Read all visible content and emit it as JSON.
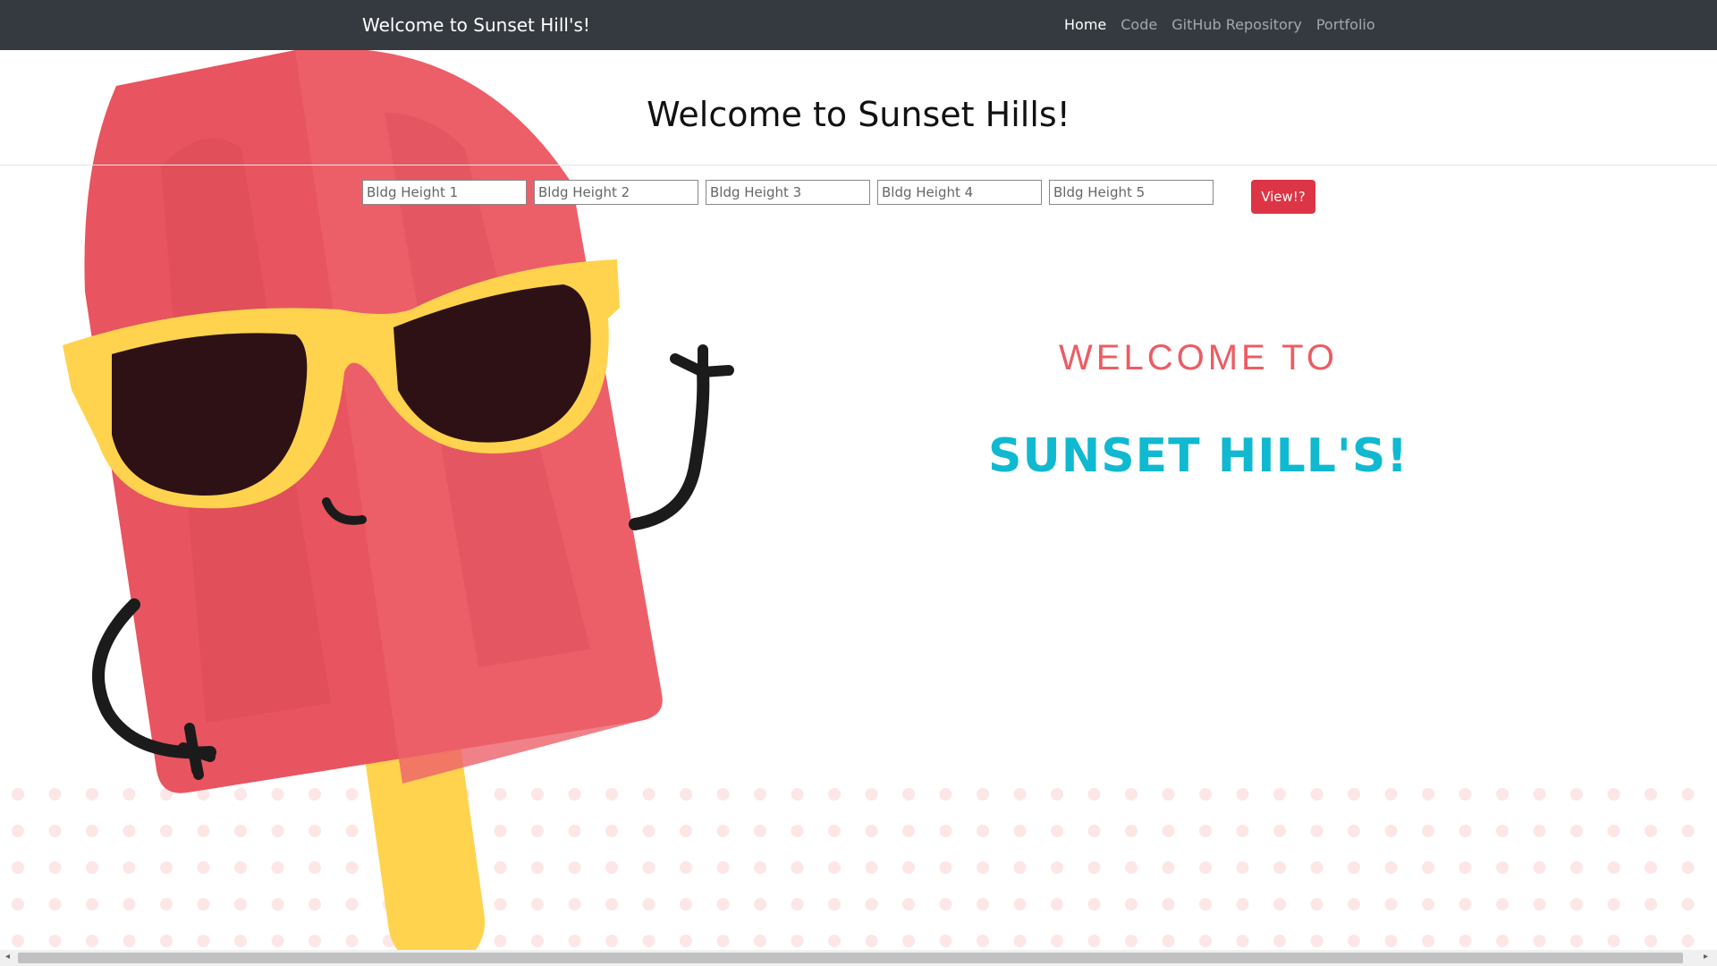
{
  "navbar": {
    "brand": "Welcome to Sunset Hill's!",
    "links": [
      {
        "label": "Home",
        "active": true
      },
      {
        "label": "Code",
        "active": false
      },
      {
        "label": "GitHub Repository",
        "active": false
      },
      {
        "label": "Portfolio",
        "active": false
      }
    ]
  },
  "header": {
    "title": "Welcome to Sunset Hills!"
  },
  "form": {
    "inputs": [
      {
        "placeholder": "Bldg Height 1",
        "value": ""
      },
      {
        "placeholder": "Bldg Height 2",
        "value": ""
      },
      {
        "placeholder": "Bldg Height 3",
        "value": ""
      },
      {
        "placeholder": "Bldg Height 4",
        "value": ""
      },
      {
        "placeholder": "Bldg Height 5",
        "value": ""
      }
    ],
    "button_label": "View!?"
  },
  "hero": {
    "line1": "WELCOME TO",
    "line2": "SUNSET HILL'S!"
  },
  "colors": {
    "navbar_bg": "#343a40",
    "button_red": "#dc3545",
    "welcome_coral": "#ec5c63",
    "sunset_teal": "#10b9d0",
    "popsicle_red": "#e8545f",
    "stick_yellow": "#ffd34e",
    "lens_dark": "#2e1115"
  },
  "icons": {
    "scroll_left": "◂",
    "scroll_right": "▸"
  }
}
